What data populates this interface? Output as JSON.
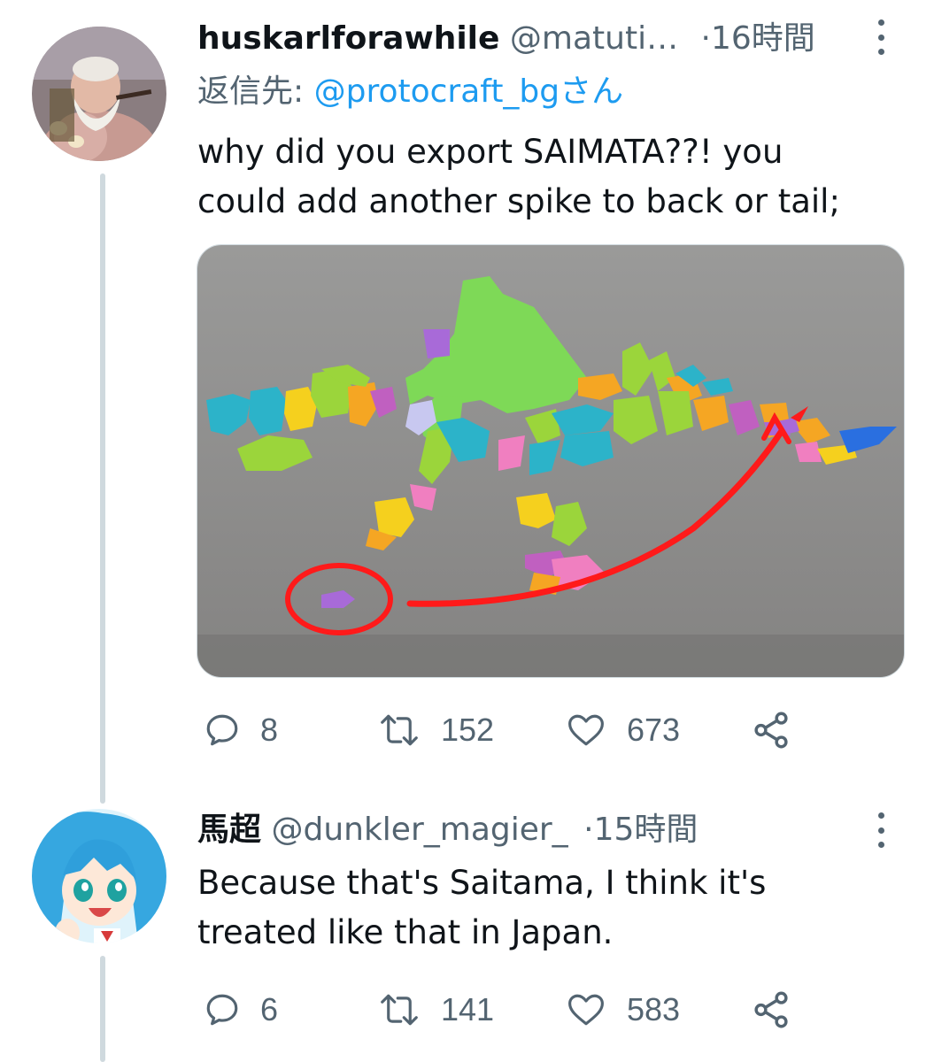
{
  "tweets": [
    {
      "display_name": "huskarlforawhile",
      "handle": "@matuti…",
      "separator": "·",
      "time": "16時間",
      "reply_label": "返信先:",
      "reply_mention": "@protocraft_bgさん",
      "text_line1": "why did you export SAIMATA??! you",
      "text_line2": "could add another spike to back or tail;",
      "replies": "8",
      "retweets": "152",
      "likes": "673",
      "avatar_icon": "bearded-warrior-avatar",
      "media_description": "japan-prefecture-puzzle-map"
    },
    {
      "display_name": "馬超",
      "handle": "@dunkler_magier_",
      "separator": "·",
      "time": "15時間",
      "text_line1": "Because that's Saitama, I think it's",
      "text_line2": "treated like that in Japan.",
      "replies": "6",
      "retweets": "141",
      "likes": "583",
      "avatar_icon": "blue-haired-anime-girl-avatar"
    }
  ],
  "colors": {
    "text": "#0f1419",
    "secondary": "#536471",
    "link": "#1d9bf0",
    "thread_line": "#cfd9de",
    "annotation_red": "#ff1a1a"
  }
}
